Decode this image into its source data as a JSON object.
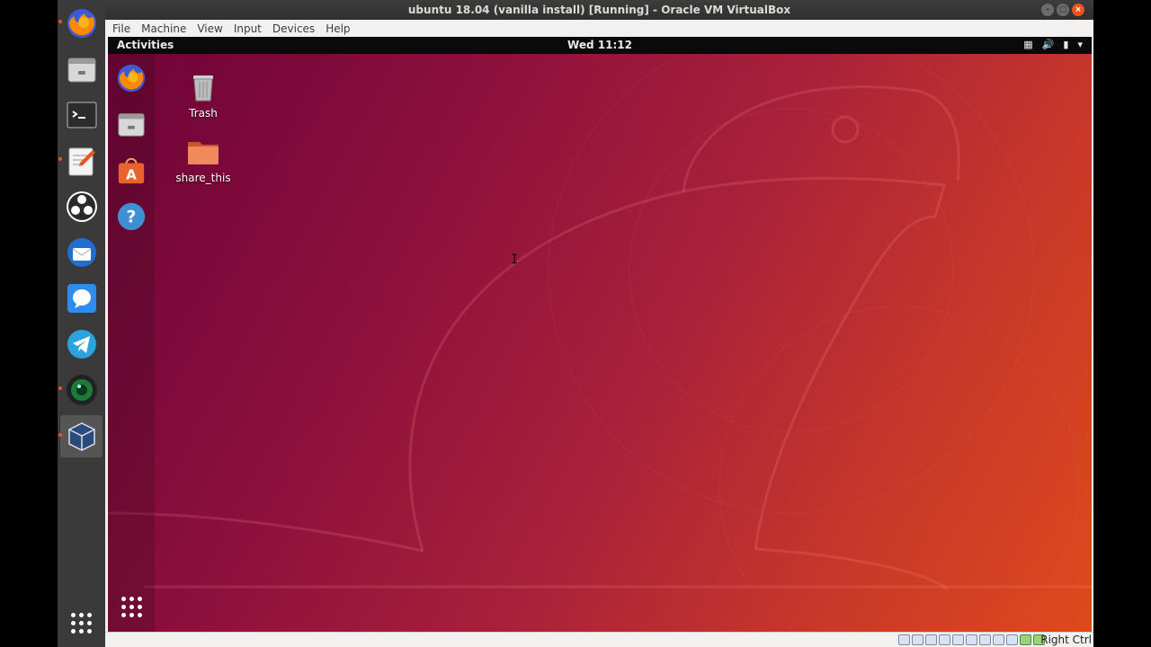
{
  "host_dock": {
    "apps": [
      {
        "name": "firefox",
        "icon": "firefox-icon",
        "running": true
      },
      {
        "name": "files",
        "icon": "file-cabinet-icon",
        "running": false
      },
      {
        "name": "terminal",
        "icon": "terminal-icon",
        "running": false
      },
      {
        "name": "text-editor",
        "icon": "text-editor-icon",
        "running": true
      },
      {
        "name": "obs",
        "icon": "obs-icon",
        "running": false
      },
      {
        "name": "thunderbird",
        "icon": "thunderbird-icon",
        "running": false
      },
      {
        "name": "signal",
        "icon": "chat-bubble-icon",
        "running": false
      },
      {
        "name": "telegram",
        "icon": "telegram-icon",
        "running": false
      },
      {
        "name": "camera",
        "icon": "camera-lens-icon",
        "running": true
      },
      {
        "name": "virtualbox",
        "icon": "virtualbox-icon",
        "running": true,
        "active": true
      }
    ]
  },
  "vbox": {
    "title": "ubuntu 18.04 (vanilla install) [Running] - Oracle VM VirtualBox",
    "menu": [
      "File",
      "Machine",
      "View",
      "Input",
      "Devices",
      "Help"
    ],
    "host_key": "Right Ctrl"
  },
  "guest": {
    "activities": "Activities",
    "clock": "Wed 11:12",
    "dock_apps": [
      "firefox-icon",
      "file-cabinet-icon",
      "software-store-icon",
      "help-icon"
    ],
    "desktop_icons": [
      {
        "label": "Trash",
        "icon": "trash-icon"
      },
      {
        "label": "share_this",
        "icon": "folder-icon"
      }
    ]
  },
  "colors": {
    "accent": "#e95420",
    "wallpaper_start": "#6d0338",
    "wallpaper_end": "#de4a1c"
  }
}
